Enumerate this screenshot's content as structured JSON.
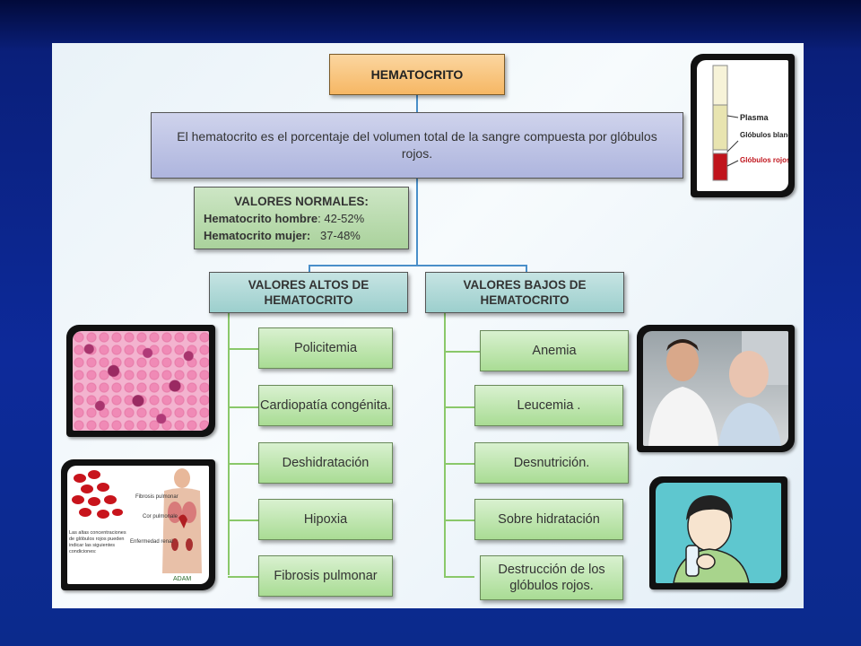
{
  "diagram": {
    "title": "HEMATOCRITO",
    "definition": "El hematocrito es el porcentaje del volumen total de la sangre compuesta por glóbulos rojos.",
    "normal_values": {
      "heading": "VALORES NORMALES:",
      "male_label": "Hematocrito hombre",
      "male_value": ": 42-52%",
      "female_label": "Hematocrito mujer:",
      "female_value": "37-48%"
    },
    "high": {
      "heading": "VALORES ALTOS DE HEMATOCRITO",
      "items": [
        "Policitemia",
        "Cardiopatía congénita.",
        "Deshidratación",
        "Hipoxia",
        "Fibrosis pulmonar"
      ]
    },
    "low": {
      "heading": "VALORES BAJOS DE HEMATOCRITO",
      "items": [
        "Anemia",
        "Leucemia .",
        "Desnutrición.",
        "Sobre hidratación",
        "Destrucción de los glóbulos rojos."
      ]
    }
  },
  "tube_image": {
    "plasma": "Plasma",
    "white_cells": "Glóbulos blancos",
    "red_cells": "Glóbulos rojos"
  },
  "anatomy_image": {
    "fibrosis": "Fibrosis pulmonar",
    "cor": "Cor pulmonale",
    "renal": "Enfermedad renal",
    "caption": "Las altas concentraciones de glóbulos rojos pueden indicar las siguientes condiciones:",
    "brand": "ADAM"
  },
  "colors": {
    "title_fill": "#f6b764",
    "definition_fill": "#aeb5de",
    "normal_fill": "#aad29c",
    "category_fill": "#9ccfcd",
    "condition_fill": "#a9dc94",
    "connector_blue": "#4a8fc9",
    "connector_green": "#8ac86a"
  }
}
